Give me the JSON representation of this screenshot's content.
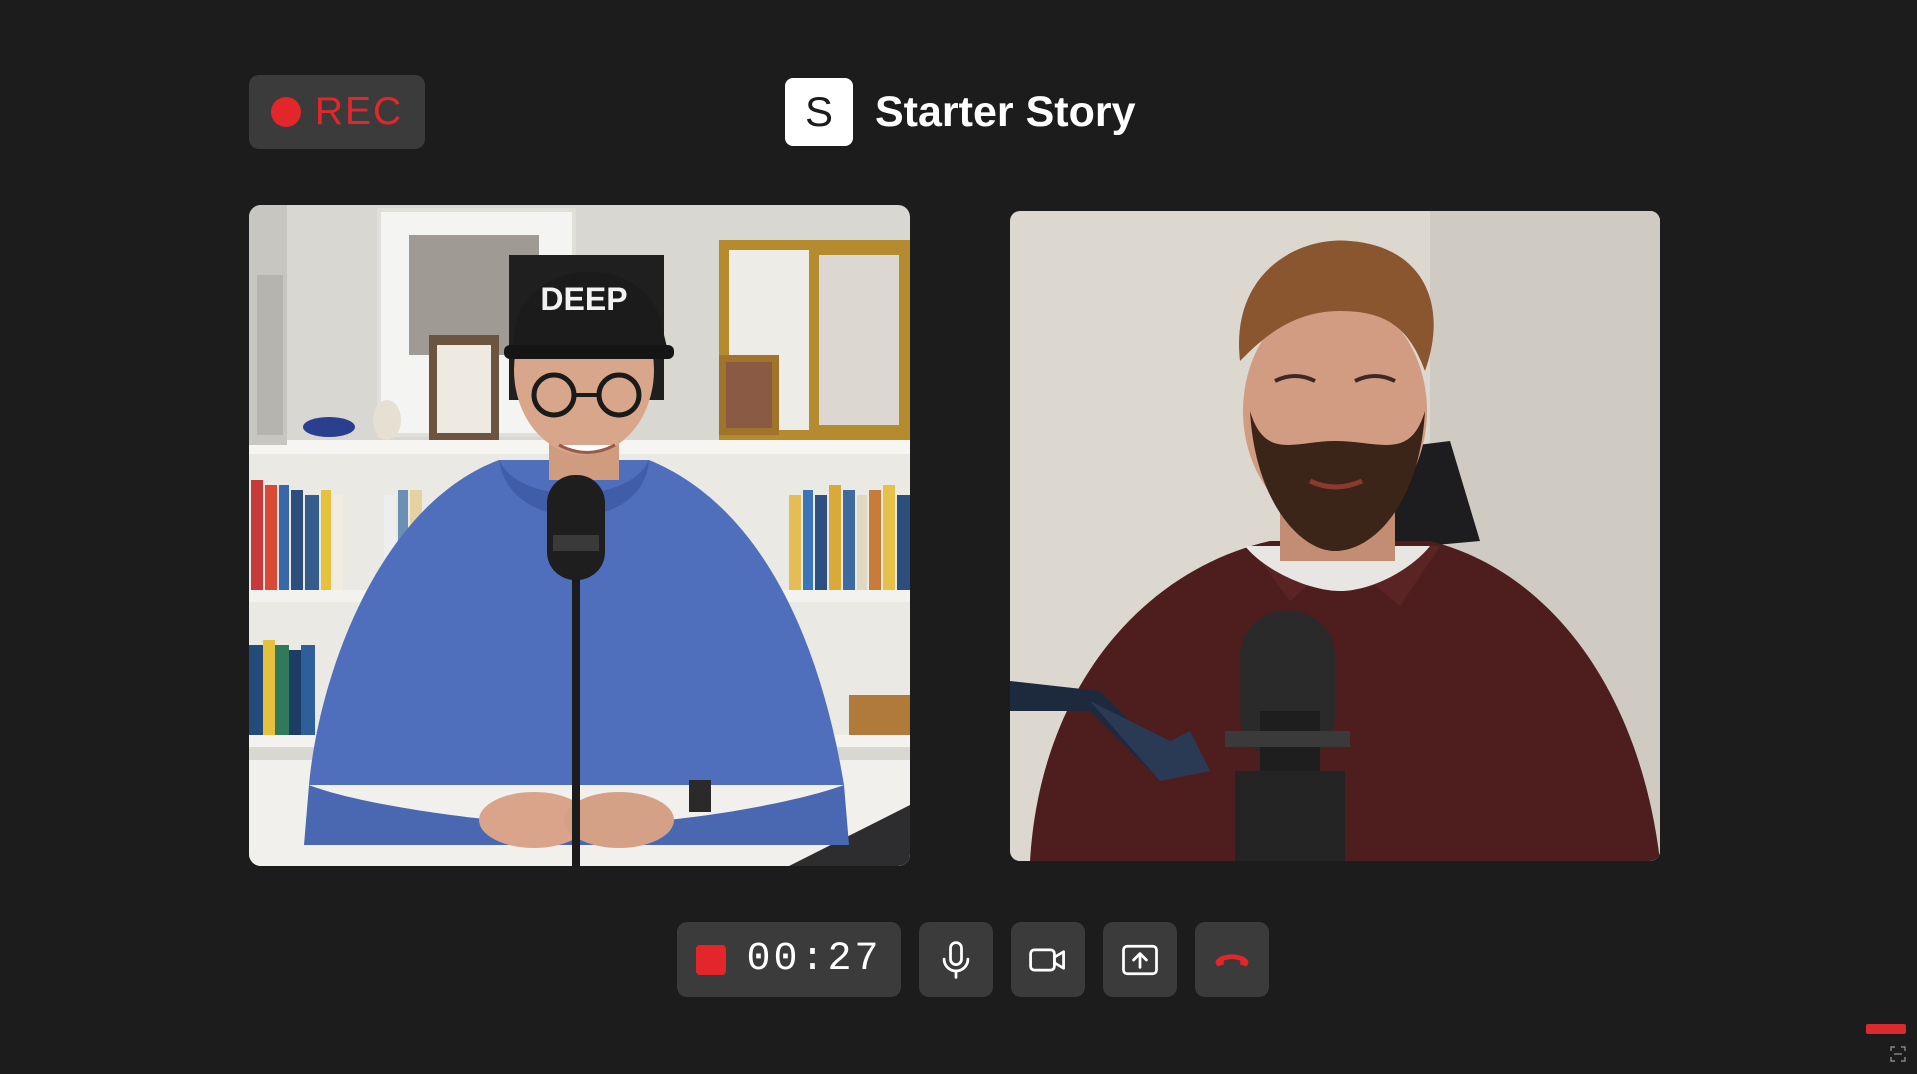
{
  "recording": {
    "label": "REC",
    "indicator_color": "#e3262a"
  },
  "brand": {
    "logo_letter": "S",
    "name": "Starter Story"
  },
  "participants": [
    {
      "tile": "left",
      "icon": "participant-video-feed"
    },
    {
      "tile": "right",
      "icon": "participant-video-feed"
    }
  ],
  "controls": {
    "timer": "00:27",
    "stop_icon": "stop-square-icon",
    "buttons": [
      {
        "id": "mic",
        "icon": "microphone-icon"
      },
      {
        "id": "camera",
        "icon": "video-camera-icon"
      },
      {
        "id": "share",
        "icon": "share-screen-icon"
      },
      {
        "id": "hangup",
        "icon": "end-call-icon",
        "color": "#e3262a"
      }
    ]
  },
  "colors": {
    "background": "#1c1c1c",
    "control_bg": "#3b3b3b",
    "accent_red": "#e3262a"
  }
}
